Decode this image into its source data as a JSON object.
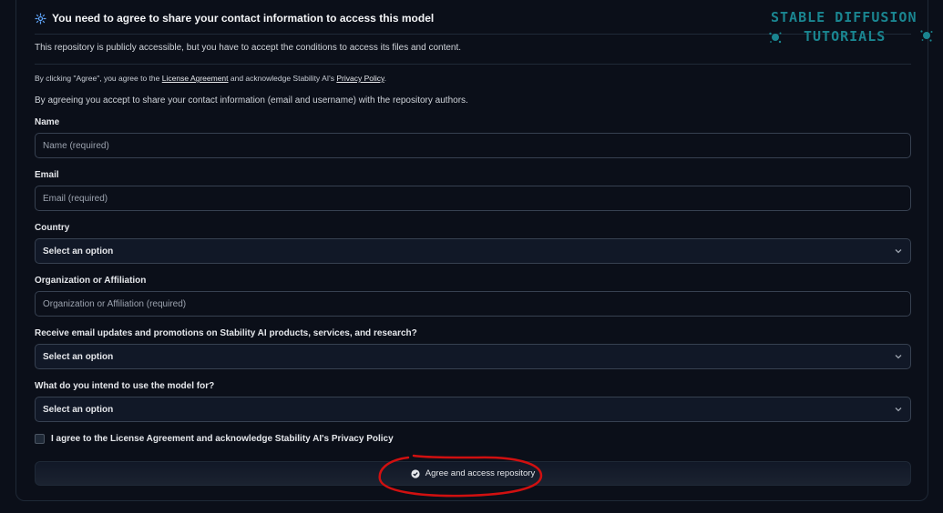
{
  "header": {
    "title": "You need to agree to share your contact information to access this model",
    "subtitle": "This repository is publicly accessible, but you have to accept the conditions to access its files and content."
  },
  "terms": {
    "prefix": "By clicking \"Agree\", you agree to the ",
    "license_link": "License Agreement",
    "middle": " and acknowledge Stability AI's ",
    "privacy_link": "Privacy Policy",
    "suffix": "."
  },
  "share_notice": "By agreeing you accept to share your contact information (email and username) with the repository authors.",
  "form": {
    "name": {
      "label": "Name",
      "placeholder": "Name (required)"
    },
    "email": {
      "label": "Email",
      "placeholder": "Email (required)"
    },
    "country": {
      "label": "Country",
      "value": "Select an option"
    },
    "organization": {
      "label": "Organization or Affiliation",
      "placeholder": "Organization or Affiliation (required)"
    },
    "updates": {
      "label": "Receive email updates and promotions on Stability AI products, services, and research?",
      "value": "Select an option"
    },
    "intended_use": {
      "label": "What do you intend to use the model for?",
      "value": "Select an option"
    },
    "agree_checkbox": {
      "label": "I agree to the License Agreement and acknowledge Stability AI's Privacy Policy",
      "checked": false
    },
    "submit_label": "Agree and access repository"
  },
  "watermark": {
    "line1": "STABLE DIFFUSION",
    "line2": "TUTORIALS",
    "color": "#1a8590"
  },
  "annotation_color": "#d01010"
}
